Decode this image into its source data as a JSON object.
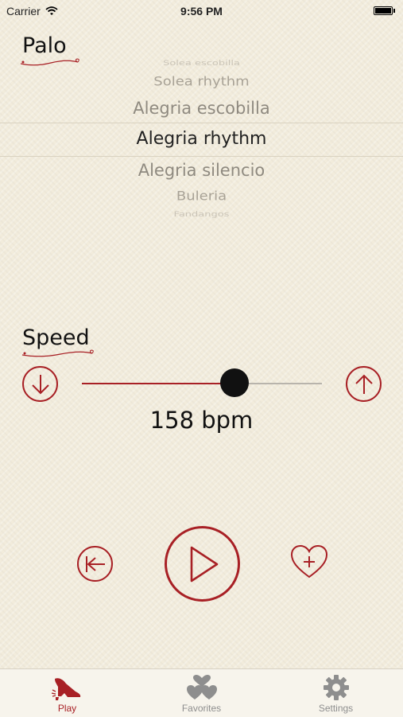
{
  "status_bar": {
    "carrier": "Carrier",
    "time": "9:56 PM"
  },
  "palo": {
    "title": "Palo",
    "items": [
      "Solea escobilla",
      "Solea rhythm",
      "Alegria escobilla",
      "Alegria rhythm",
      "Alegria silencio",
      "Buleria",
      "Fandangos"
    ],
    "selected": "Alegria rhythm"
  },
  "speed": {
    "title": "Speed",
    "bpm_label": "158 bpm",
    "level": 0.63
  },
  "tabs": [
    {
      "label": "Play",
      "icon": "flamenco-shoe-icon",
      "active": true
    },
    {
      "label": "Favorites",
      "icon": "hearts-icon",
      "active": false
    },
    {
      "label": "Settings",
      "icon": "gear-icon",
      "active": false
    }
  ],
  "colors": {
    "accent": "#a82025",
    "background": "#f2ecdc",
    "inactive": "#8e8e8e"
  }
}
